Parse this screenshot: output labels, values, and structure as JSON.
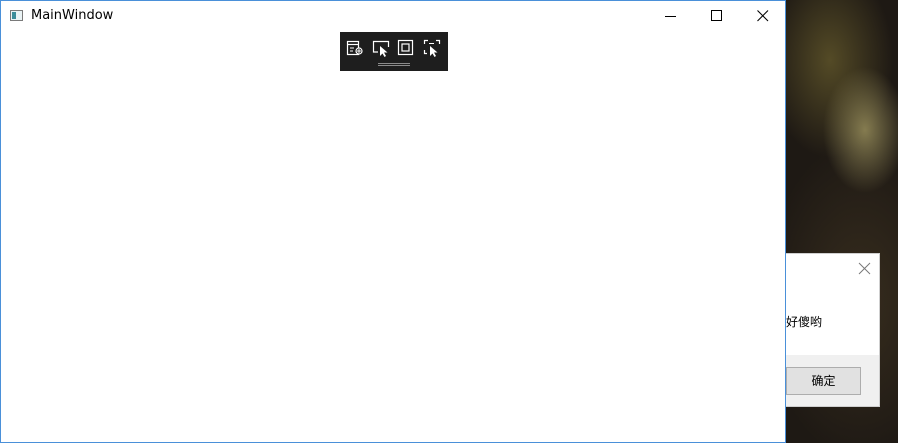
{
  "window": {
    "title": "MainWindow",
    "icon": "app-window-icon",
    "caption_buttons": [
      "minimize-icon",
      "maximize-icon",
      "close-icon"
    ],
    "border_color": "#4a90d9"
  },
  "debug_toolbar": {
    "background": "#1e1e1e",
    "buttons": [
      {
        "icon": "live-visual-tree-icon"
      },
      {
        "icon": "select-element-icon"
      },
      {
        "icon": "display-layout-adorners-icon"
      },
      {
        "icon": "track-focused-element-icon"
      }
    ]
  },
  "dialog": {
    "message": "好傻哟",
    "ok_label": "确定",
    "close_icon": "close-icon"
  }
}
